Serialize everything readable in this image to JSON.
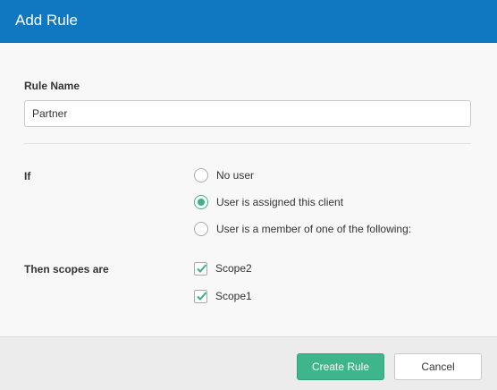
{
  "dialog": {
    "title": "Add Rule"
  },
  "form": {
    "rule_name_label": "Rule Name",
    "rule_name_value": "Partner",
    "if_label": "If",
    "if_options": [
      {
        "label": "No user",
        "checked": false
      },
      {
        "label": "User is assigned this client",
        "checked": true
      },
      {
        "label": "User is a member of one of the following:",
        "checked": false
      }
    ],
    "scopes_label": "Then scopes are",
    "scopes": [
      {
        "label": "Scope2",
        "checked": true
      },
      {
        "label": "Scope1",
        "checked": true
      }
    ]
  },
  "footer": {
    "create_label": "Create Rule",
    "cancel_label": "Cancel"
  },
  "colors": {
    "header": "#0f78c1",
    "accent": "#3fb58c"
  }
}
